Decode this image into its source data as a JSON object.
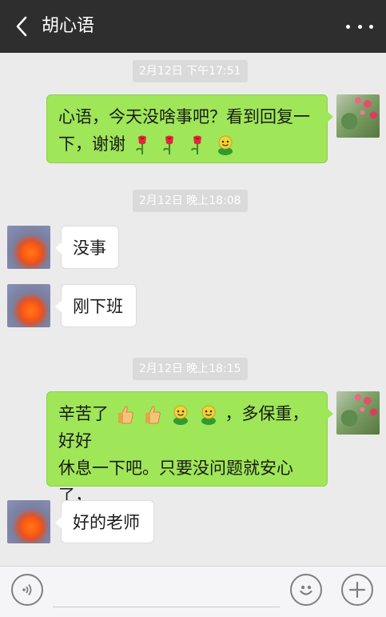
{
  "header": {
    "title": "胡心语",
    "back_icon": "chevron-left-icon",
    "more_icon": "more-dots-icon"
  },
  "messages": [
    {
      "type": "timestamp",
      "text": "2月12日 下午17:51"
    },
    {
      "type": "outgoing",
      "lines": [
        "心语，今天没啥事吧？看到回复一",
        "下，谢谢"
      ],
      "emoji": [
        "rose-icon",
        "rose-icon",
        "rose-icon",
        "smiley-face-icon"
      ]
    },
    {
      "type": "timestamp",
      "text": "2月12日 晚上18:08"
    },
    {
      "type": "incoming",
      "text": "没事"
    },
    {
      "type": "incoming",
      "text": "刚下班"
    },
    {
      "type": "timestamp",
      "text": "2月12日 晚上18:15"
    },
    {
      "type": "outgoing",
      "lines": [
        "辛苦了",
        "，多保重，好好",
        "休息一下吧。只要没问题就安心",
        "了，"
      ],
      "emoji": [
        "thumbs-up-icon",
        "thumbs-up-icon",
        "smiley-face-icon",
        "smiley-face-icon"
      ]
    },
    {
      "type": "incoming",
      "text": "好的老师"
    }
  ],
  "input_bar": {
    "voice_icon": "voice-icon",
    "emoji_icon": "emoji-face-icon",
    "plus_icon": "plus-icon"
  },
  "colors": {
    "header_bg": "#2e2e2e",
    "chat_bg": "#ebebeb",
    "outgoing_bubble": "#9fe658",
    "incoming_bubble": "#ffffff"
  }
}
